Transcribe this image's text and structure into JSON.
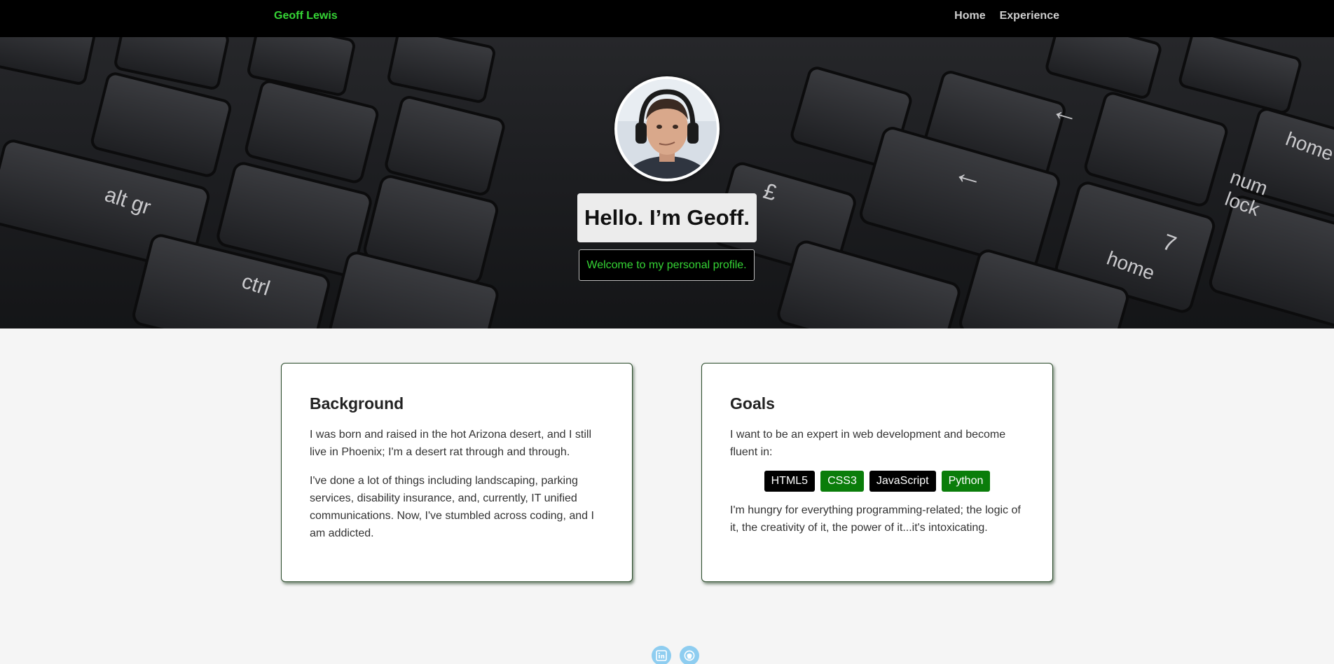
{
  "navbar": {
    "brand": "Geoff Lewis",
    "links": [
      {
        "label": "Home"
      },
      {
        "label": "Experience"
      }
    ]
  },
  "hero": {
    "title": "Hello. I’m Geoff.",
    "subtitle": "Welcome to my personal profile.",
    "avatar_icon": "profile-photo",
    "keyboard_labels": [
      "alt gr",
      "ctrl",
      "num lock",
      "home",
      "7",
      "£",
      "home"
    ]
  },
  "background_card": {
    "heading": "Background",
    "paragraphs": [
      "I was born and raised in the hot Arizona desert, and I still live in Phoenix; I'm a desert rat through and through.",
      "I've done a lot of things including landscaping, parking services, disability insurance, and, currently, IT unified communications. Now, I've stumbled across coding, and I am addicted."
    ]
  },
  "goals_card": {
    "heading": "Goals",
    "intro": "I want to be an expert in web development and become fluent in:",
    "skills": [
      {
        "label": "HTML5",
        "style": "dark"
      },
      {
        "label": "CSS3",
        "style": "green"
      },
      {
        "label": "JavaScript",
        "style": "dark"
      },
      {
        "label": "Python",
        "style": "green"
      }
    ],
    "outro": "I'm hungry for everything programming-related; the logic of it, the creativity of it, the power of it...it's intoxicating."
  },
  "footer": {
    "icons": [
      "linkedin-icon",
      "github-icon"
    ]
  },
  "colors": {
    "brand_green": "#35d435",
    "badge_green": "#0a7d0a",
    "nav_bg": "#000000",
    "page_bg": "#f5f5f5",
    "social_bg": "#8ecdf0"
  }
}
